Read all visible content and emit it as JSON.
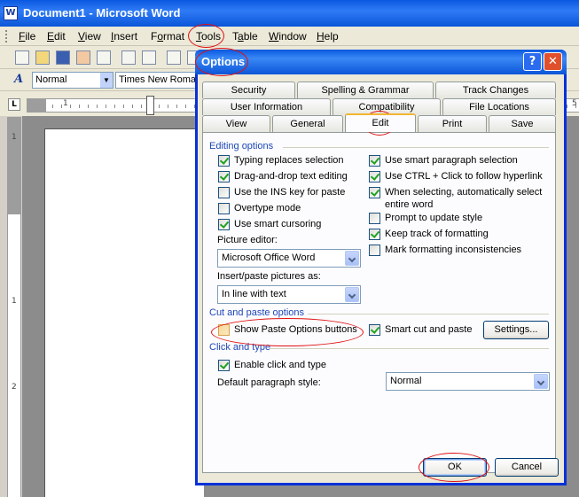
{
  "word": {
    "title": "Document1 - Microsoft Word",
    "menu": [
      {
        "pre": "",
        "u": "F",
        "post": "ile"
      },
      {
        "pre": "",
        "u": "E",
        "post": "dit"
      },
      {
        "pre": "",
        "u": "V",
        "post": "iew"
      },
      {
        "pre": "",
        "u": "I",
        "post": "nsert"
      },
      {
        "pre": "F",
        "u": "o",
        "post": "rmat"
      },
      {
        "pre": "",
        "u": "T",
        "post": "ools"
      },
      {
        "pre": "T",
        "u": "a",
        "post": "ble"
      },
      {
        "pre": "",
        "u": "W",
        "post": "indow"
      },
      {
        "pre": "",
        "u": "H",
        "post": "elp"
      }
    ],
    "style_value": "Normal",
    "font_value": "Times New Roman",
    "ruler_numbers": [
      "1",
      "5"
    ],
    "vruler_numbers": [
      "1",
      "1",
      "2"
    ]
  },
  "dialog": {
    "title": "Options",
    "help_glyph": "?",
    "close_glyph": "✕",
    "tabs_row1": [
      "Security",
      "Spelling & Grammar",
      "Track Changes"
    ],
    "tabs_row2": [
      "User Information",
      "Compatibility",
      "File Locations"
    ],
    "tabs_row3": [
      "View",
      "General",
      "Edit",
      "Print",
      "Save"
    ],
    "active_tab": "Edit",
    "editing_options": {
      "label": "Editing options",
      "left": [
        {
          "label": "Typing replaces selection",
          "checked": true
        },
        {
          "label": "Drag-and-drop text editing",
          "checked": true
        },
        {
          "label": "Use the INS key for paste",
          "checked": false
        },
        {
          "label": "Overtype mode",
          "checked": false
        },
        {
          "label": "Use smart cursoring",
          "checked": true
        }
      ],
      "right": [
        {
          "label": "Use smart paragraph selection",
          "checked": true
        },
        {
          "label": "Use CTRL + Click to follow hyperlink",
          "checked": true
        },
        {
          "label": "When selecting, automatically select",
          "label2": "entire word",
          "checked": true
        },
        {
          "label": "Prompt to update style",
          "checked": false
        },
        {
          "label": "Keep track of formatting",
          "checked": true
        },
        {
          "label": "Mark formatting inconsistencies",
          "checked": false
        }
      ],
      "picture_editor_label": "Picture editor:",
      "picture_editor_value": "Microsoft Office Word",
      "insert_paste_label": "Insert/paste pictures as:",
      "insert_paste_value": "In line with text"
    },
    "cut_paste": {
      "label": "Cut and paste options",
      "show_paste_options": {
        "label": "Show Paste Options buttons",
        "checked": false
      },
      "smart_cut": {
        "label": "Smart cut and paste",
        "checked": true
      },
      "settings_button": "Settings..."
    },
    "click_type": {
      "label": "Click and type",
      "enable": {
        "label": "Enable click and type",
        "checked": true
      },
      "default_style_label": "Default paragraph style:",
      "default_style_value": "Normal"
    },
    "ok_button": "OK",
    "cancel_button": "Cancel"
  },
  "colors": {
    "annotation": "#e01010",
    "title_bar": "#0a58e0",
    "group_label": "#1d47b8"
  }
}
